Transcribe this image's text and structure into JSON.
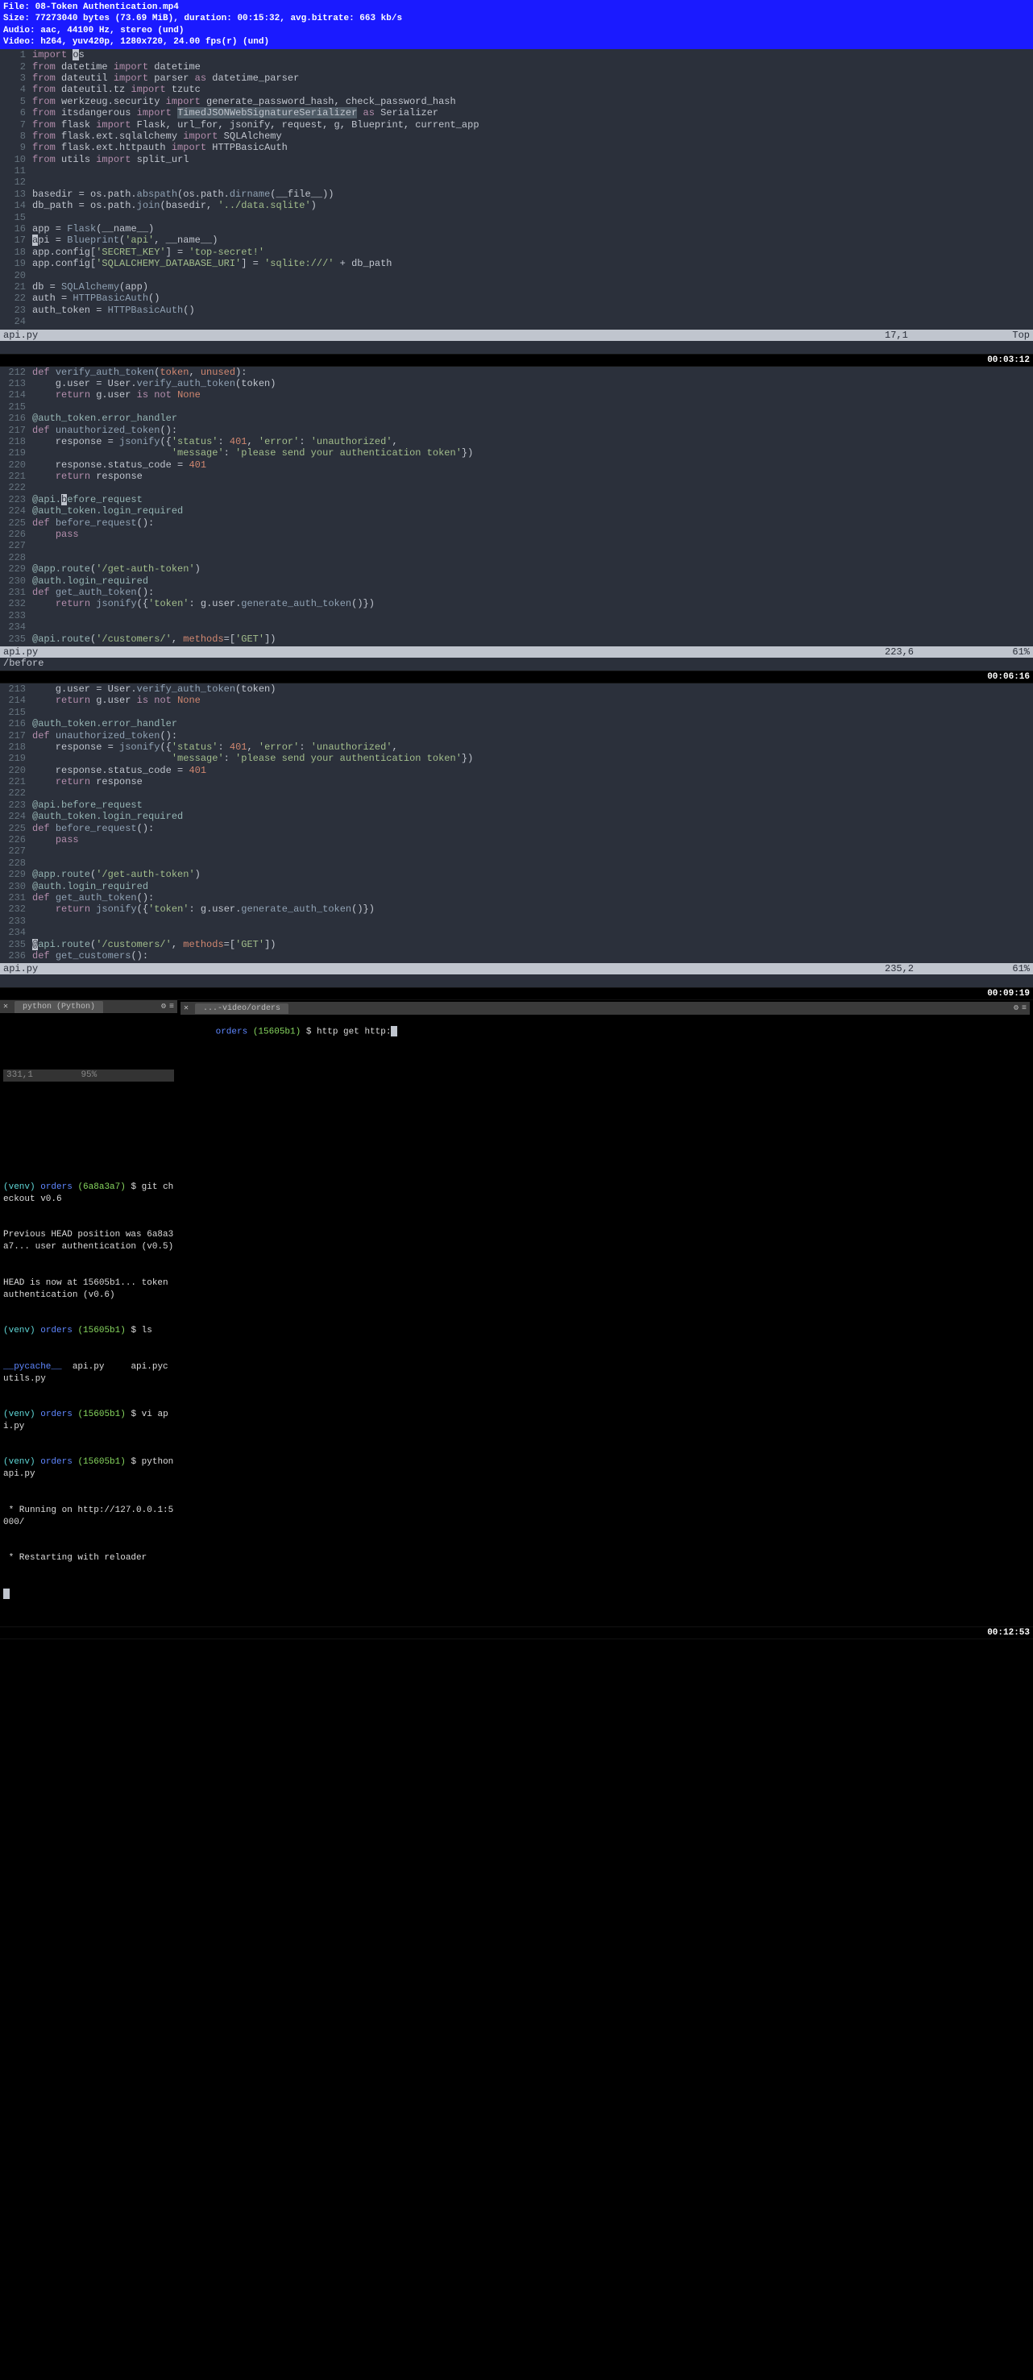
{
  "media_info": {
    "file": "File: 08-Token Authentication.mp4",
    "size": "Size: 77273040 bytes (73.69 MiB), duration: 00:15:32, avg.bitrate: 663 kb/s",
    "audio": "Audio: aac, 44100 Hz, stereo (und)",
    "video": "Video: h264, yuv420p, 1280x720, 24.00 fps(r) (und)"
  },
  "pane1": {
    "status": {
      "file": "api.py",
      "pos": "17,1",
      "pct": "Top"
    },
    "cmdline": ""
  },
  "timestamps": {
    "t1": "00:03:12",
    "t2": "00:06:16",
    "t3": "00:09:19",
    "t4": "00:12:53"
  },
  "pane2": {
    "status": {
      "file": "api.py",
      "pos": "223,6",
      "pct": "61%"
    },
    "cmdline": "/before"
  },
  "pane3": {
    "status": {
      "file": "api.py",
      "pos": "235,2",
      "pct": "61%"
    },
    "cmdline": ""
  },
  "term_left": {
    "tab": "python (Python)",
    "status_left": "331,1",
    "status_right": "95%",
    "lines": {
      "l1a": "(venv) ",
      "l1b": "orders ",
      "l1c": "(6a8a3a7)",
      "l1d": " $ git checkout v0.6",
      "l2": "Previous HEAD position was 6a8a3a7... user authentication (v0.5)",
      "l3": "HEAD is now at 15605b1... token authentication (v0.6)",
      "l4a": "(venv) ",
      "l4b": "orders ",
      "l4c": "(15605b1)",
      "l4d": " $ ls",
      "l5a": "__pycache__",
      "l5b": "  api.py     api.pyc     utils.py",
      "l6a": "(venv) ",
      "l6b": "orders ",
      "l6c": "(15605b1)",
      "l6d": " $ vi api.py",
      "l7a": "(venv) ",
      "l7b": "orders ",
      "l7c": "(15605b1)",
      "l7d": " $ python api.py",
      "l8": " * Running on http://127.0.0.1:5000/",
      "l9": " * Restarting with reloader"
    }
  },
  "term_right": {
    "tab": "...-video/orders",
    "prompt_a": "orders ",
    "prompt_b": "(15605b1)",
    "prompt_c": " $ http get http:"
  }
}
